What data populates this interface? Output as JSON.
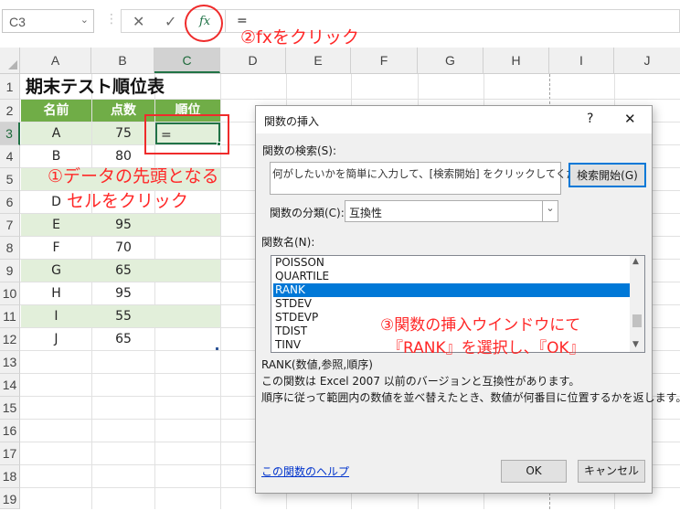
{
  "formula_bar": {
    "name_box": "C3",
    "name_box_arrow": "⌄",
    "separator": "⋮",
    "cancel_icon": "✕",
    "enter_icon": "✓",
    "fx_label": "fx",
    "formula": "="
  },
  "annotations": {
    "step2": "②fxをクリック",
    "step1_line1": "①データの先頭となる",
    "step1_line2": "セルをクリック",
    "step3_line1": "③関数の挿入ウインドウにて",
    "step3_line2": "『RANK』を選択し、『OK』"
  },
  "columns": [
    "A",
    "B",
    "C",
    "D",
    "E",
    "F",
    "G",
    "H",
    "I",
    "J"
  ],
  "rows": [
    "1",
    "2",
    "3",
    "4",
    "5",
    "6",
    "7",
    "8",
    "9",
    "10",
    "11",
    "12",
    "13",
    "14",
    "15",
    "16",
    "17",
    "18",
    "19",
    "20"
  ],
  "sheet": {
    "title": "期末テスト順位表",
    "headers": [
      "名前",
      "点数",
      "順位"
    ],
    "data": [
      {
        "name": "A",
        "score": "75",
        "rank": "="
      },
      {
        "name": "B",
        "score": "80",
        "rank": ""
      },
      {
        "name": "C",
        "score": "",
        "rank": ""
      },
      {
        "name": "D",
        "score": "",
        "rank": ""
      },
      {
        "name": "E",
        "score": "95",
        "rank": ""
      },
      {
        "name": "F",
        "score": "70",
        "rank": ""
      },
      {
        "name": "G",
        "score": "65",
        "rank": ""
      },
      {
        "name": "H",
        "score": "95",
        "rank": ""
      },
      {
        "name": "I",
        "score": "55",
        "rank": ""
      },
      {
        "name": "J",
        "score": "65",
        "rank": ""
      }
    ]
  },
  "dialog": {
    "title": "関数の挿入",
    "help_icon": "?",
    "close_icon": "✕",
    "search_label": "関数の検索(S):",
    "search_value": "何がしたいかを簡単に入力して、[検索開始] をクリックしてください。",
    "search_button": "検索開始(G)",
    "category_label": "関数の分類(C):",
    "category_value": "互換性",
    "select_arrow": "⌄",
    "list_label": "関数名(N):",
    "functions": [
      "POISSON",
      "QUARTILE",
      "RANK",
      "STDEV",
      "STDEVP",
      "TDIST",
      "TINV"
    ],
    "selected_function": "RANK",
    "scroll_up": "▲",
    "scroll_down": "▼",
    "syntax": "RANK(数値,参照,順序)",
    "desc_line1": "この関数は Excel 2007 以前のバージョンと互換性があります。",
    "desc_line2": "順序に従って範囲内の数値を並べ替えたとき、数値が何番目に位置するかを返します。",
    "help_link": "この関数のヘルプ",
    "ok_button": "OK",
    "cancel_button": "キャンセル"
  },
  "colors": {
    "header_green": "#70ad47",
    "band_green": "#e2efda",
    "annotation_red": "#ff2828",
    "selection_blue": "#0078d7"
  }
}
